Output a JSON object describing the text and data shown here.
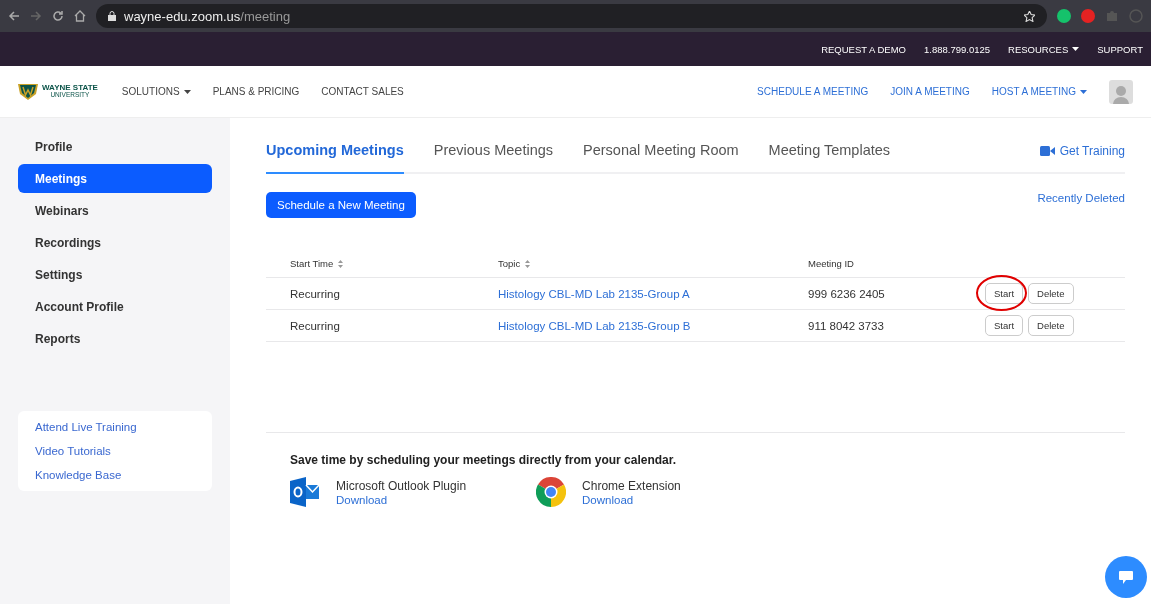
{
  "browser": {
    "url_host": "wayne-edu.zoom.us",
    "url_path": "/meeting"
  },
  "top_bar": {
    "links": [
      {
        "label": "REQUEST A DEMO",
        "dropdown": false
      },
      {
        "label": "1.888.799.0125",
        "dropdown": false
      },
      {
        "label": "RESOURCES",
        "dropdown": true
      },
      {
        "label": "SUPPORT",
        "dropdown": false
      }
    ]
  },
  "nav": {
    "logo": {
      "line_1": "WAYNE STATE",
      "line_2": "UNIVERSITY"
    },
    "left_links": [
      {
        "label": "SOLUTIONS",
        "dropdown": true
      },
      {
        "label": "PLANS & PRICING",
        "dropdown": false
      },
      {
        "label": "CONTACT SALES",
        "dropdown": false
      }
    ],
    "right_links": [
      {
        "label": "SCHEDULE A MEETING",
        "dropdown": false
      },
      {
        "label": "JOIN A MEETING",
        "dropdown": false
      },
      {
        "label": "HOST A MEETING",
        "dropdown": true
      }
    ]
  },
  "sidebar": {
    "items": [
      {
        "label": "Profile",
        "selected": false
      },
      {
        "label": "Meetings",
        "selected": true
      },
      {
        "label": "Webinars",
        "selected": false
      },
      {
        "label": "Recordings",
        "selected": false
      },
      {
        "label": "Settings",
        "selected": false
      },
      {
        "label": "Account Profile",
        "selected": false
      },
      {
        "label": "Reports",
        "selected": false
      }
    ],
    "help_links": [
      "Attend Live Training",
      "Video Tutorials",
      "Knowledge Base"
    ]
  },
  "tabs": [
    {
      "label": "Upcoming Meetings",
      "selected": true
    },
    {
      "label": "Previous Meetings",
      "selected": false
    },
    {
      "label": "Personal Meeting Room",
      "selected": false
    },
    {
      "label": "Meeting Templates",
      "selected": false
    }
  ],
  "get_training": "Get Training",
  "schedule_button": "Schedule a New Meeting",
  "recently_deleted": "Recently Deleted",
  "table": {
    "columns": [
      {
        "label": "Start Time",
        "sortable": true
      },
      {
        "label": "Topic",
        "sortable": true
      },
      {
        "label": "Meeting ID",
        "sortable": false
      }
    ],
    "rows": [
      {
        "start_time": "Recurring",
        "topic": "Histology CBL-MD Lab 2135-Group A",
        "meeting_id": "999 6236 2405",
        "start": "Start",
        "delete": "Delete",
        "circled": true
      },
      {
        "start_time": "Recurring",
        "topic": "Histology CBL-MD Lab 2135-Group B",
        "meeting_id": "911 8042 3733",
        "start": "Start",
        "delete": "Delete",
        "circled": false
      }
    ]
  },
  "calendar": {
    "heading": "Save time by scheduling your meetings directly from your calendar.",
    "plugins": [
      {
        "kind": "outlook",
        "name": "Microsoft Outlook Plugin",
        "link": "Download"
      },
      {
        "kind": "chrome",
        "name": "Chrome Extension",
        "link": "Download"
      }
    ]
  }
}
